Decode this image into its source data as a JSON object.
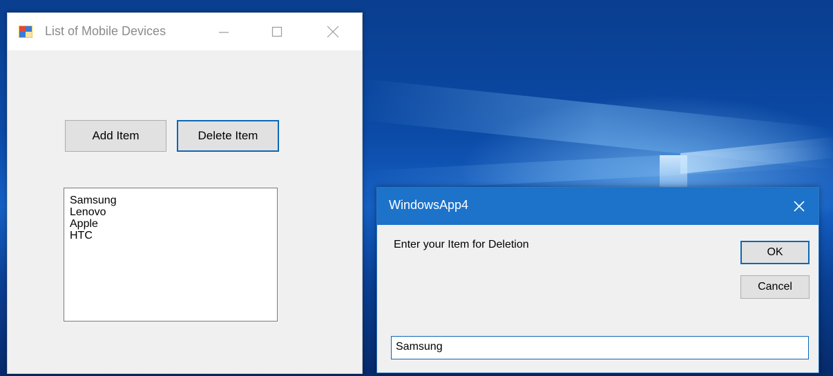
{
  "main_window": {
    "title": "List of Mobile Devices",
    "add_button_label": "Add Item",
    "delete_button_label": "Delete Item",
    "list_items": [
      "Samsung",
      "Lenovo",
      "Apple",
      "HTC"
    ]
  },
  "dialog": {
    "title": "WindowsApp4",
    "prompt": "Enter your Item for Deletion",
    "ok_label": "OK",
    "cancel_label": "Cancel",
    "input_value": "Samsung"
  },
  "icons": {
    "minimize": "minimize-icon",
    "maximize": "maximize-icon",
    "close": "close-icon",
    "app": "app-icon"
  },
  "colors": {
    "dialog_titlebar": "#1c73c9",
    "focus_border": "#0a67b8",
    "window_bg": "#f0f0f0"
  }
}
